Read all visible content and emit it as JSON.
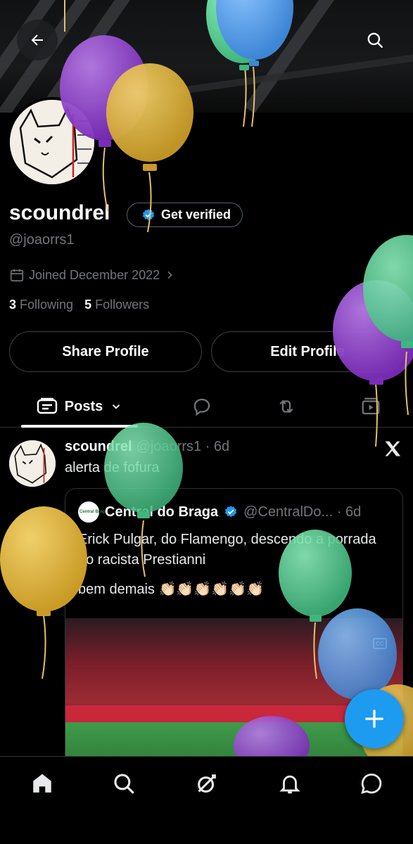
{
  "profile": {
    "name": "scoundrel",
    "verify_label": "Get verified",
    "handle": "@joaorrs1",
    "joined": "Joined December 2022",
    "following_count": "3",
    "following_label": "Following",
    "followers_count": "5",
    "followers_label": "Followers"
  },
  "actions": {
    "share_label": "Share Profile",
    "edit_label": "Edit Profile"
  },
  "tabs": [
    {
      "label": "Posts",
      "icon": "posts-icon"
    },
    {
      "label": "",
      "icon": "replies-icon"
    },
    {
      "label": "",
      "icon": "reposts-icon"
    },
    {
      "label": "",
      "icon": "media-icon"
    }
  ],
  "post": {
    "author": "scoundrel",
    "meta": "@joaorrs1 · 6d",
    "text": "alerta de fofura",
    "quote": {
      "logo_text": "Central Braga",
      "author": "Central do Braga",
      "meta": "@CentralDo... · 6d",
      "text": "Erick Pulgar, do Flamengo, descendo a porrada no racista Prestianni",
      "text2": "bem demais 👏🏻👏🏻👏🏻👏🏻👏🏻👏🏻",
      "caption_badge": "CC"
    }
  },
  "nav": [
    "home-icon",
    "search-icon",
    "grok-icon",
    "notifications-icon",
    "messages-icon"
  ],
  "colors": {
    "accent": "#1d9bf0",
    "balloon_purple": "#8e3fc9",
    "balloon_yellow": "#d9b23a",
    "balloon_green": "#5dcf95",
    "balloon_blue": "#4f9ee8"
  }
}
